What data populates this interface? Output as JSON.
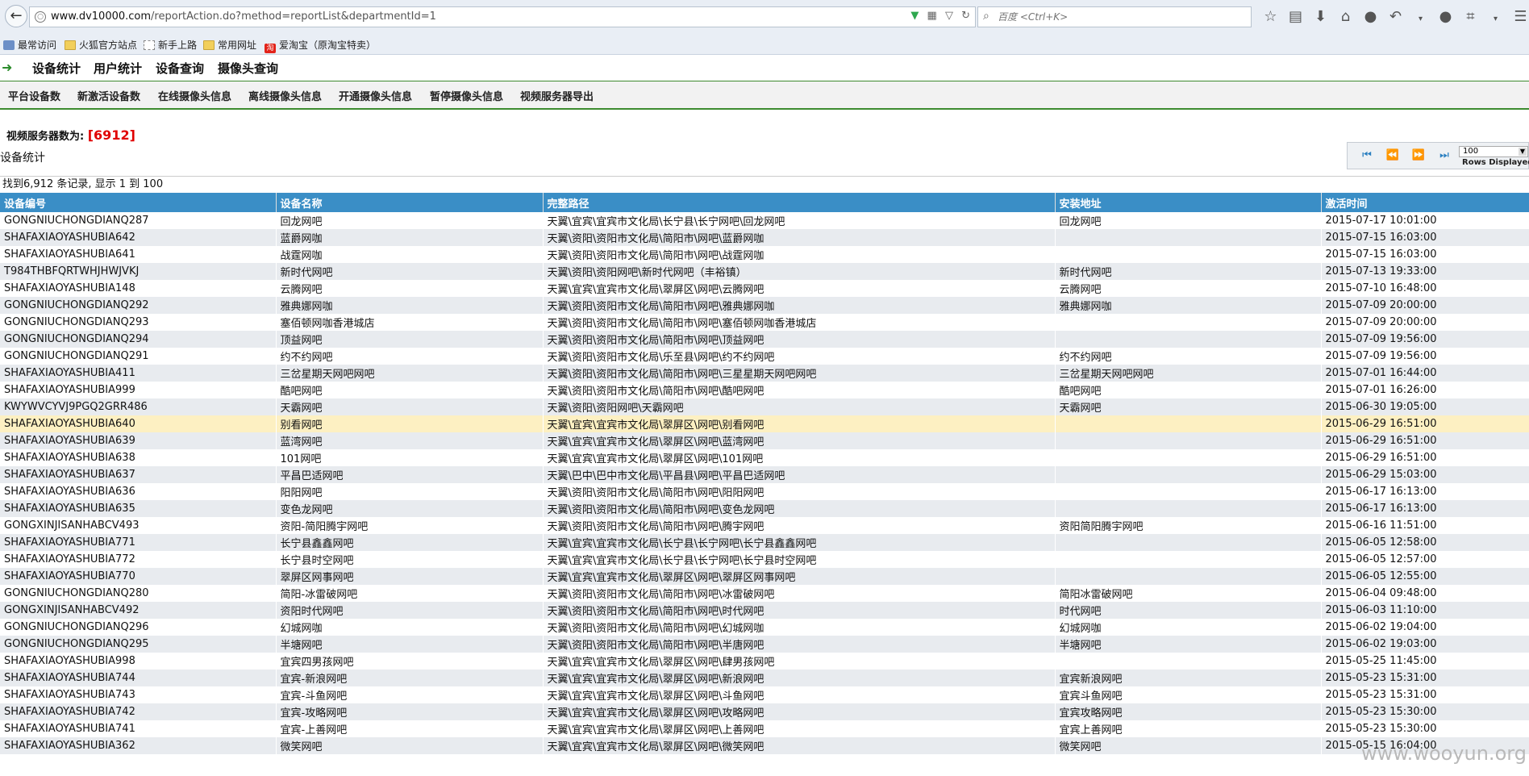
{
  "browser": {
    "url_host": "www.dv10000.com",
    "url_path": "/reportAction.do?method=reportList&departmentId=1",
    "search_placeholder": "百度 <Ctrl+K>"
  },
  "bookmarks": [
    {
      "label": "最常访问",
      "icon": "recent-icon"
    },
    {
      "label": "火狐官方站点",
      "icon": "folder-icon"
    },
    {
      "label": "新手上路",
      "icon": "page-icon"
    },
    {
      "label": "常用网址",
      "icon": "folder-icon"
    },
    {
      "label": "爱淘宝（原淘宝特卖）",
      "icon": "taobao-icon"
    }
  ],
  "app_nav": [
    "设备统计",
    "用户统计",
    "设备查询",
    "摄像头查询"
  ],
  "sub_nav": [
    "平台设备数",
    "新激活设备数",
    "在线摄像头信息",
    "离线摄像头信息",
    "开通摄像头信息",
    "暂停摄像头信息",
    "视频服务器导出"
  ],
  "summary": {
    "label": "视频服务器数为:",
    "value": "[6912]"
  },
  "section_title": "设备统计",
  "pager": {
    "rows": "100",
    "rows_label": "Rows Displayed"
  },
  "found_text": "找到6,912 条记录, 显示 1 到 100",
  "table": {
    "columns": [
      "设备编号",
      "设备名称",
      "完整路径",
      "安装地址",
      "激活时间"
    ],
    "rows": [
      [
        "GONGNIUCHONGDIANQ287",
        "回龙网吧",
        "天翼\\宜宾\\宜宾市文化局\\长宁县\\长宁网吧\\回龙网吧",
        "回龙网吧",
        "2015-07-17 10:01:00"
      ],
      [
        "SHAFAXIAOYASHUBIA642",
        "蓝爵网咖",
        "天翼\\资阳\\资阳市文化局\\简阳市\\网吧\\蓝爵网咖",
        "",
        "2015-07-15 16:03:00"
      ],
      [
        "SHAFAXIAOYASHUBIA641",
        "战霆网咖",
        "天翼\\资阳\\资阳市文化局\\简阳市\\网吧\\战霆网咖",
        "",
        "2015-07-15 16:03:00"
      ],
      [
        "T984THBFQRTWHJHWJVKJ",
        "新时代网吧",
        "天翼\\资阳\\资阳网吧\\新时代网吧（丰裕镇）",
        "新时代网吧",
        "2015-07-13 19:33:00"
      ],
      [
        "SHAFAXIAOYASHUBIA148",
        "云腾网吧",
        "天翼\\宜宾\\宜宾市文化局\\翠屏区\\网吧\\云腾网吧",
        "云腾网吧",
        "2015-07-10 16:48:00"
      ],
      [
        "GONGNIUCHONGDIANQ292",
        "雅典娜网咖",
        "天翼\\资阳\\资阳市文化局\\简阳市\\网吧\\雅典娜网咖",
        "雅典娜网咖",
        "2015-07-09 20:00:00"
      ],
      [
        "GONGNIUCHONGDIANQ293",
        "塞佰顿网咖香港城店",
        "天翼\\资阳\\资阳市文化局\\简阳市\\网吧\\塞佰顿网咖香港城店",
        "",
        "2015-07-09 20:00:00"
      ],
      [
        "GONGNIUCHONGDIANQ294",
        "顶益网吧",
        "天翼\\资阳\\资阳市文化局\\简阳市\\网吧\\顶益网吧",
        "",
        "2015-07-09 19:56:00"
      ],
      [
        "GONGNIUCHONGDIANQ291",
        "约不约网吧",
        "天翼\\资阳\\资阳市文化局\\乐至县\\网吧\\约不约网吧",
        "约不约网吧",
        "2015-07-09 19:56:00"
      ],
      [
        "SHAFAXIAOYASHUBIA411",
        "三岔星期天网吧网吧",
        "天翼\\资阳\\资阳市文化局\\简阳市\\网吧\\三星星期天网吧网吧",
        "三岔星期天网吧网吧",
        "2015-07-01 16:44:00"
      ],
      [
        "SHAFAXIAOYASHUBIA999",
        "酷吧网吧",
        "天翼\\资阳\\资阳市文化局\\简阳市\\网吧\\酷吧网吧",
        "酷吧网吧",
        "2015-07-01 16:26:00"
      ],
      [
        "KWYWVCYVJ9PGQ2GRR486",
        "天霸网吧",
        "天翼\\资阳\\资阳网吧\\天霸网吧",
        "天霸网吧",
        "2015-06-30 19:05:00"
      ],
      [
        "SHAFAXIAOYASHUBIA640",
        "别看网吧",
        "天翼\\宜宾\\宜宾市文化局\\翠屏区\\网吧\\别看网吧",
        "",
        "2015-06-29 16:51:00"
      ],
      [
        "SHAFAXIAOYASHUBIA639",
        "蓝湾网吧",
        "天翼\\宜宾\\宜宾市文化局\\翠屏区\\网吧\\蓝湾网吧",
        "",
        "2015-06-29 16:51:00"
      ],
      [
        "SHAFAXIAOYASHUBIA638",
        "101网吧",
        "天翼\\宜宾\\宜宾市文化局\\翠屏区\\网吧\\101网吧",
        "",
        "2015-06-29 16:51:00"
      ],
      [
        "SHAFAXIAOYASHUBIA637",
        "平昌巴适网吧",
        "天翼\\巴中\\巴中市文化局\\平昌县\\网吧\\平昌巴适网吧",
        "",
        "2015-06-29 15:03:00"
      ],
      [
        "SHAFAXIAOYASHUBIA636",
        "阳阳网吧",
        "天翼\\资阳\\资阳市文化局\\简阳市\\网吧\\阳阳网吧",
        "",
        "2015-06-17 16:13:00"
      ],
      [
        "SHAFAXIAOYASHUBIA635",
        "变色龙网吧",
        "天翼\\资阳\\资阳市文化局\\简阳市\\网吧\\变色龙网吧",
        "",
        "2015-06-17 16:13:00"
      ],
      [
        "GONGXINJISANHABCV493",
        "资阳-简阳腾宇网吧",
        "天翼\\资阳\\资阳市文化局\\简阳市\\网吧\\腾宇网吧",
        "资阳简阳腾宇网吧",
        "2015-06-16 11:51:00"
      ],
      [
        "SHAFAXIAOYASHUBIA771",
        "长宁县鑫鑫网吧",
        "天翼\\宜宾\\宜宾市文化局\\长宁县\\长宁网吧\\长宁县鑫鑫网吧",
        "",
        "2015-06-05 12:58:00"
      ],
      [
        "SHAFAXIAOYASHUBIA772",
        "长宁县时空网吧",
        "天翼\\宜宾\\宜宾市文化局\\长宁县\\长宁网吧\\长宁县时空网吧",
        "",
        "2015-06-05 12:57:00"
      ],
      [
        "SHAFAXIAOYASHUBIA770",
        "翠屏区网事网吧",
        "天翼\\宜宾\\宜宾市文化局\\翠屏区\\网吧\\翠屏区网事网吧",
        "",
        "2015-06-05 12:55:00"
      ],
      [
        "GONGNIUCHONGDIANQ280",
        "简阳-冰雷破网吧",
        "天翼\\资阳\\资阳市文化局\\简阳市\\网吧\\冰雷破网吧",
        "简阳冰雷破网吧",
        "2015-06-04 09:48:00"
      ],
      [
        "GONGXINJISANHABCV492",
        "资阳时代网吧",
        "天翼\\资阳\\资阳市文化局\\简阳市\\网吧\\时代网吧",
        "时代网吧",
        "2015-06-03 11:10:00"
      ],
      [
        "GONGNIUCHONGDIANQ296",
        "幻城网咖",
        "天翼\\资阳\\资阳市文化局\\简阳市\\网吧\\幻城网咖",
        "幻城网咖",
        "2015-06-02 19:04:00"
      ],
      [
        "GONGNIUCHONGDIANQ295",
        "半塘网吧",
        "天翼\\资阳\\资阳市文化局\\简阳市\\网吧\\半唐网吧",
        "半塘网吧",
        "2015-06-02 19:03:00"
      ],
      [
        "SHAFAXIAOYASHUBIA998",
        "宜宾四男孩网吧",
        "天翼\\宜宾\\宜宾市文化局\\翠屏区\\网吧\\肆男孩网吧",
        "",
        "2015-05-25 11:45:00"
      ],
      [
        "SHAFAXIAOYASHUBIA744",
        "宜宾-新浪网吧",
        "天翼\\宜宾\\宜宾市文化局\\翠屏区\\网吧\\新浪网吧",
        "宜宾新浪网吧",
        "2015-05-23 15:31:00"
      ],
      [
        "SHAFAXIAOYASHUBIA743",
        "宜宾-斗鱼网吧",
        "天翼\\宜宾\\宜宾市文化局\\翠屏区\\网吧\\斗鱼网吧",
        "宜宾斗鱼网吧",
        "2015-05-23 15:31:00"
      ],
      [
        "SHAFAXIAOYASHUBIA742",
        "宜宾-攻略网吧",
        "天翼\\宜宾\\宜宾市文化局\\翠屏区\\网吧\\攻略网吧",
        "宜宾攻略网吧",
        "2015-05-23 15:30:00"
      ],
      [
        "SHAFAXIAOYASHUBIA741",
        "宜宾-上善网吧",
        "天翼\\宜宾\\宜宾市文化局\\翠屏区\\网吧\\上善网吧",
        "宜宾上善网吧",
        "2015-05-23 15:30:00"
      ],
      [
        "SHAFAXIAOYASHUBIA362",
        "微笑网吧",
        "天翼\\宜宾\\宜宾市文化局\\翠屏区\\网吧\\微笑网吧",
        "微笑网吧",
        "2015-05-15 16:04:00"
      ]
    ],
    "highlighted_row": 12
  },
  "watermark": "www.wooyun.org"
}
